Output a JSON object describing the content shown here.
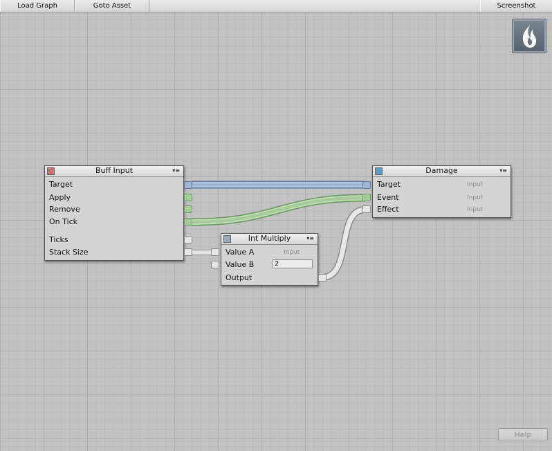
{
  "toolbar": {
    "load_graph": "Load Graph",
    "goto_asset": "Goto Asset",
    "screenshot": "Screenshot"
  },
  "colors": {
    "target_wire": "#92aed0",
    "event_wire": "#a4cb98",
    "value_wire": "#e4e4e4"
  },
  "nodes": {
    "buff_input": {
      "title": "Buff Input",
      "menu": "▾≡",
      "ports": [
        "Target",
        "Apply",
        "Remove",
        "On Tick",
        "Ticks",
        "Stack Size"
      ]
    },
    "damage": {
      "title": "Damage",
      "menu": "▾≡",
      "ports": [
        "Target",
        "Event",
        "Effect"
      ],
      "hints": [
        "Input",
        "Input",
        "Input"
      ]
    },
    "int_multiply": {
      "title": "Int Multiply",
      "menu": "▾≡",
      "value_a": "Value A",
      "value_a_hint": "Input",
      "value_b": "Value B",
      "value_b_value": "2",
      "output": "Output"
    }
  },
  "help_button": "Help"
}
